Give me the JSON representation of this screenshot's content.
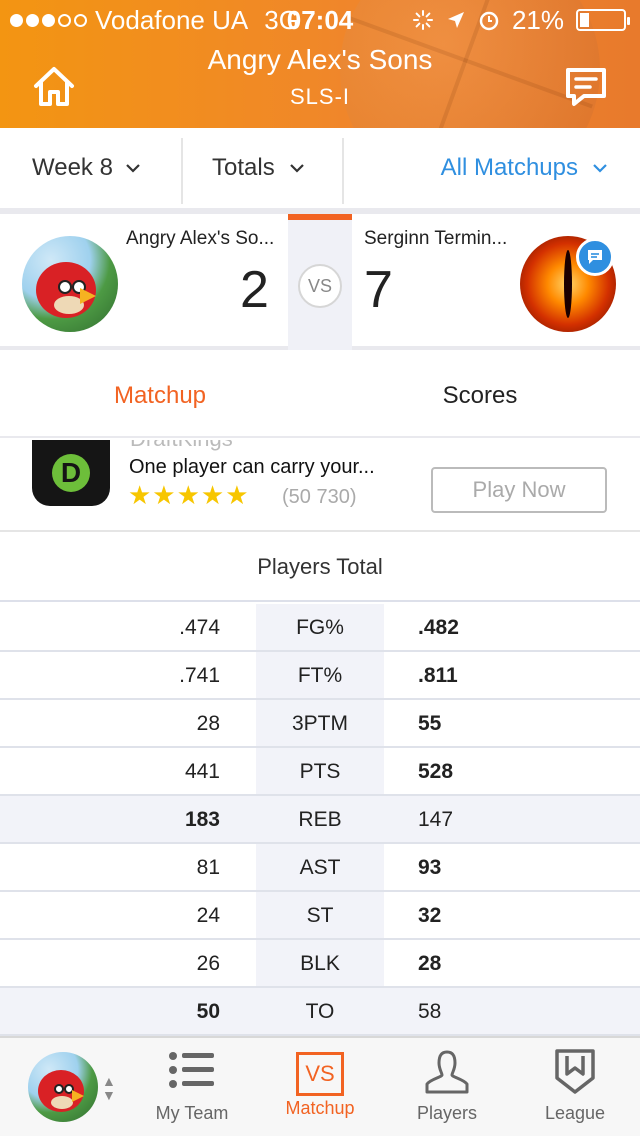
{
  "status_bar": {
    "carrier": "Vodafone UA",
    "network": "3G",
    "time": "07:04",
    "battery": "21%",
    "battery_level": 0.21,
    "signal_bars_filled": 3,
    "signal_bars_total": 5
  },
  "header": {
    "title": "Angry Alex's Sons",
    "subtitle": "SLS-I"
  },
  "filters": {
    "week": "Week 8",
    "totals": "Totals",
    "matchups": "All Matchups"
  },
  "matchup": {
    "left_team": "Angry Alex's So...",
    "left_score": "2",
    "vs_label": "VS",
    "right_team": "Serginn Termin...",
    "right_score": "7"
  },
  "tabs": {
    "matchup": "Matchup",
    "scores": "Scores"
  },
  "ad": {
    "brand_cutoff": "DraftKings",
    "text": "One player can carry your...",
    "stars": "★★★★★",
    "rating_count": "(50 730)",
    "button": "Play Now"
  },
  "players_total": {
    "title": "Players Total",
    "rows": [
      {
        "left": ".474",
        "stat": "FG%",
        "right": ".482",
        "winner": "right"
      },
      {
        "left": ".741",
        "stat": "FT%",
        "right": ".811",
        "winner": "right"
      },
      {
        "left": "28",
        "stat": "3PTM",
        "right": "55",
        "winner": "right"
      },
      {
        "left": "441",
        "stat": "PTS",
        "right": "528",
        "winner": "right"
      },
      {
        "left": "183",
        "stat": "REB",
        "right": "147",
        "winner": "left"
      },
      {
        "left": "81",
        "stat": "AST",
        "right": "93",
        "winner": "right"
      },
      {
        "left": "24",
        "stat": "ST",
        "right": "32",
        "winner": "right"
      },
      {
        "left": "26",
        "stat": "BLK",
        "right": "28",
        "winner": "right"
      },
      {
        "left": "50",
        "stat": "TO",
        "right": "58",
        "winner": "left"
      }
    ]
  },
  "tab_bar": {
    "my_team": "My Team",
    "matchup": "Matchup",
    "matchup_icon_text": "VS",
    "players": "Players",
    "league": "League",
    "updown": "▲▼"
  },
  "colors": {
    "accent_orange": "#f26322",
    "link_blue": "#2f8fe0",
    "header_orange": "#f39512"
  }
}
